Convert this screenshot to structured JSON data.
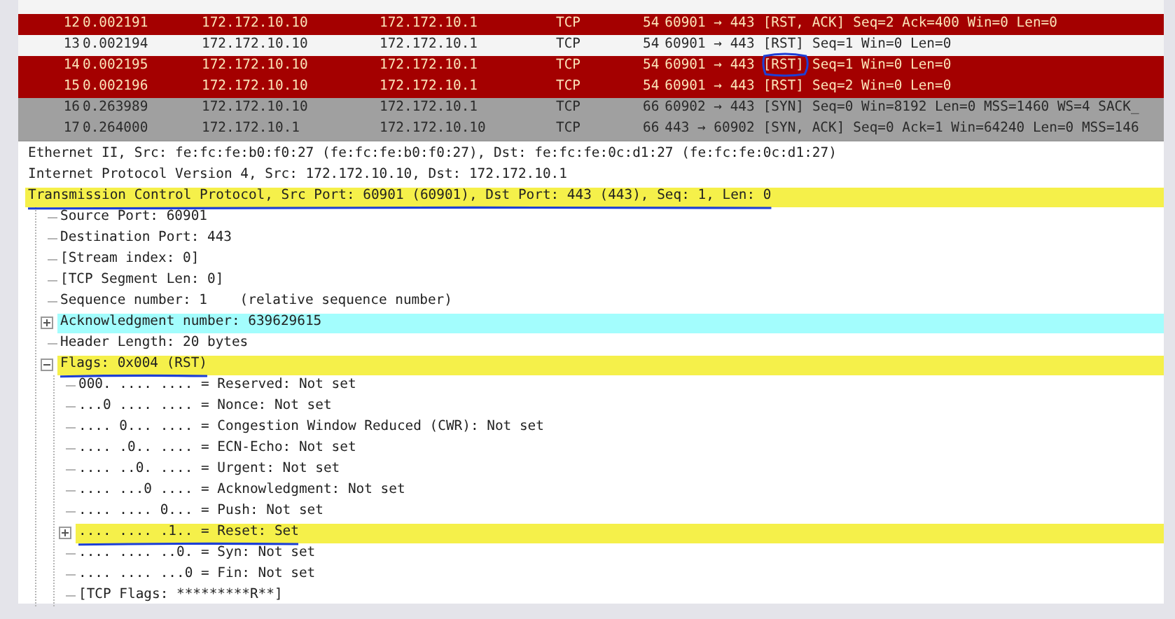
{
  "packets": [
    {
      "no": "12",
      "time": "0.002191",
      "source": "172.172.10.10",
      "destination": "172.172.10.1",
      "protocol": "TCP",
      "length": "54",
      "ports": "60901 → 443",
      "flags": "[RST, ACK]",
      "details": "Seq=2 Ack=400 Win=0 Len=0",
      "color": "#a40000",
      "circled": false
    },
    {
      "no": "13",
      "time": "0.002194",
      "source": "172.172.10.10",
      "destination": "172.172.10.1",
      "protocol": "TCP",
      "length": "54",
      "ports": "60901 → 443",
      "flags": "[RST]",
      "details": "Seq=1 Win=0 Len=0",
      "color": "#f4f4f4",
      "circled": false
    },
    {
      "no": "14",
      "time": "0.002195",
      "source": "172.172.10.10",
      "destination": "172.172.10.1",
      "protocol": "TCP",
      "length": "54",
      "ports": "60901 → 443",
      "flags": "[RST]",
      "details": "Seq=1 Win=0 Len=0",
      "color": "#a40000",
      "circled": true
    },
    {
      "no": "15",
      "time": "0.002196",
      "source": "172.172.10.10",
      "destination": "172.172.10.1",
      "protocol": "TCP",
      "length": "54",
      "ports": "60901 → 443",
      "flags": "[RST]",
      "details": "Seq=2 Win=0 Len=0",
      "color": "#a40000",
      "circled": false
    },
    {
      "no": "16",
      "time": "0.263989",
      "source": "172.172.10.10",
      "destination": "172.172.10.1",
      "protocol": "TCP",
      "length": "66",
      "ports": "60902 → 443",
      "flags": "[SYN]",
      "details": "Seq=0 Win=8192 Len=0 MSS=1460 WS=4 SACK_",
      "color": "#a0a0a0",
      "circled": false
    },
    {
      "no": "17",
      "time": "0.264000",
      "source": "172.172.10.1",
      "destination": "172.172.10.10",
      "protocol": "TCP",
      "length": "66",
      "ports": "443 → 60902",
      "flags": "[SYN, ACK]",
      "details": "Seq=0 Ack=1 Win=64240 Len=0 MSS=146",
      "color": "#a0a0a0",
      "circled": false
    }
  ],
  "details_tree": [
    {
      "label": "Ethernet II, Src: fe:fc:fe:b0:f0:27 (fe:fc:fe:b0:f0:27), Dst: fe:fc:fe:0c:d1:27 (fe:fc:fe:0c:d1:27)"
    },
    {
      "label": "Internet Protocol Version 4, Src: 172.172.10.10, Dst: 172.172.10.1"
    },
    {
      "label": "Transmission Control Protocol, Src Port: 60901 (60901), Dst Port: 443 (443), Seq: 1, Len: 0",
      "color": "#f5f04a",
      "underlined": true,
      "expanded": true,
      "children": [
        {
          "label": "Source Port: 60901"
        },
        {
          "label": "Destination Port: 443"
        },
        {
          "label": "[Stream index: 0]"
        },
        {
          "label": "[TCP Segment Len: 0]"
        },
        {
          "label": "Sequence number: 1    (relative sequence number)"
        },
        {
          "label": "Acknowledgment number: 639629615",
          "color": "#a3fdfd",
          "expanded": false
        },
        {
          "label": "Header Length: 20 bytes"
        },
        {
          "label": "Flags: 0x004 (RST)",
          "color": "#f5f04a",
          "underlined": true,
          "expanded": true,
          "children": [
            {
              "label": "000. .... .... = Reserved: Not set"
            },
            {
              "label": "...0 .... .... = Nonce: Not set"
            },
            {
              "label": ".... 0... .... = Congestion Window Reduced (CWR): Not set"
            },
            {
              "label": ".... .0.. .... = ECN-Echo: Not set"
            },
            {
              "label": ".... ..0. .... = Urgent: Not set"
            },
            {
              "label": ".... ...0 .... = Acknowledgment: Not set"
            },
            {
              "label": ".... .... 0... = Push: Not set"
            },
            {
              "label": ".... .... .1.. = Reset: Set",
              "color": "#f5f04a",
              "underlined": true,
              "expanded": false
            },
            {
              "label": ".... .... ..0. = Syn: Not set"
            },
            {
              "label": ".... .... ...0 = Fin: Not set"
            },
            {
              "label": "[TCP Flags: *********R**]"
            }
          ]
        }
      ]
    }
  ]
}
